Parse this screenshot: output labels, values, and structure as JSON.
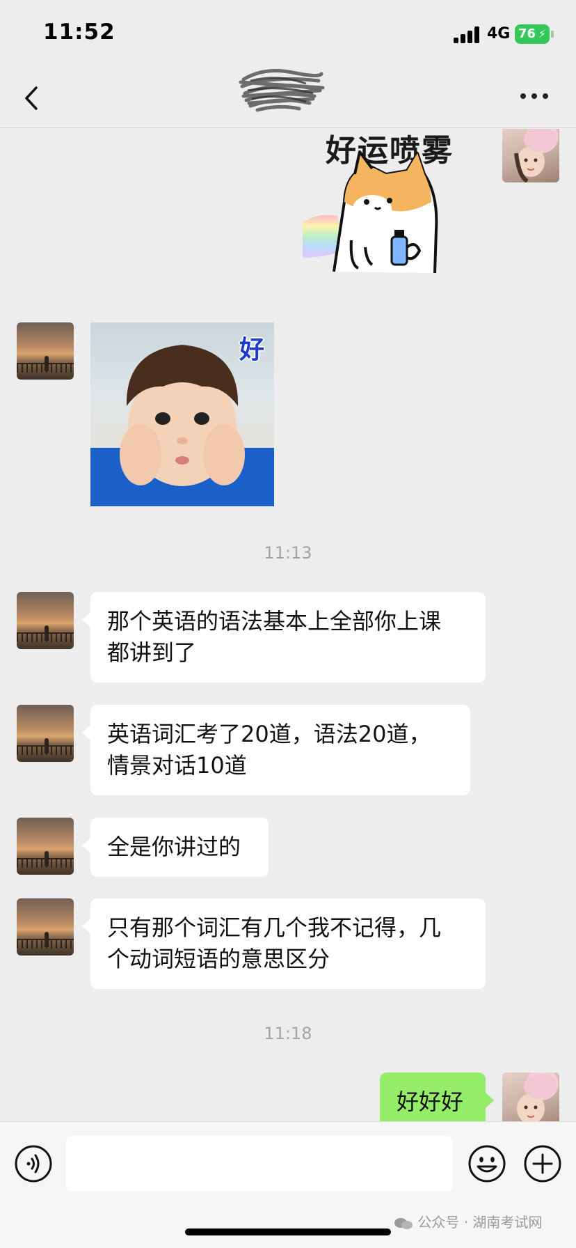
{
  "status_bar": {
    "time": "11:52",
    "network": "4G",
    "battery": "76"
  },
  "nav": {
    "back_label": "",
    "title": ""
  },
  "messages": [
    {
      "type": "sticker",
      "side": "right",
      "sticker": "corgi-rainbow",
      "caption": "好运喷雾"
    },
    {
      "type": "sticker",
      "side": "left",
      "sticker": "boy-cheeks",
      "caption": "好"
    },
    {
      "type": "time",
      "text": "11:13"
    },
    {
      "type": "text",
      "side": "left",
      "lines": [
        "那个英语的语法基本上全部你上课",
        "都讲到了"
      ]
    },
    {
      "type": "text",
      "side": "left",
      "lines": [
        "英语词汇考了20道，语法20道，",
        "情景对话10道"
      ]
    },
    {
      "type": "text",
      "side": "left",
      "lines": [
        "全是你讲过的"
      ]
    },
    {
      "type": "text",
      "side": "left",
      "lines": [
        "只有那个词汇有几个我不记得，几",
        "个动词短语的意思区分"
      ]
    },
    {
      "type": "time",
      "text": "11:18"
    },
    {
      "type": "text",
      "side": "right",
      "lines": [
        "好好好"
      ]
    }
  ],
  "input": {
    "placeholder": ""
  },
  "watermark": "公众号 · 湖南考试网",
  "colors": {
    "background": "#ededed",
    "bubble_incoming": "#ffffff",
    "bubble_outgoing": "#95ec69",
    "battery": "#34c759"
  }
}
